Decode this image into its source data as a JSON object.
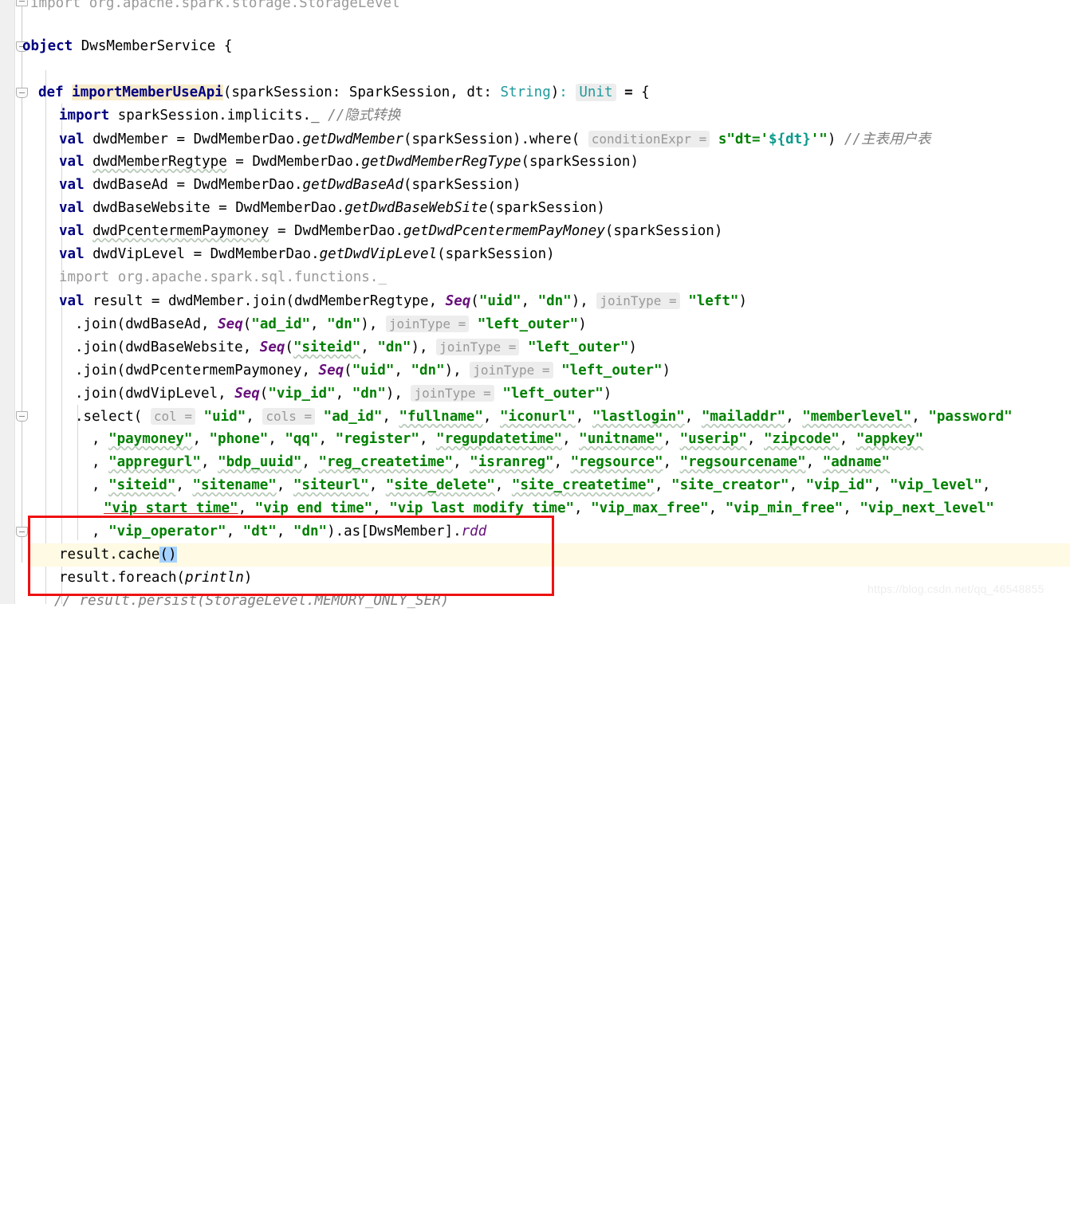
{
  "editor": {
    "language": "Scala",
    "theme_background": "#ffffff",
    "gutter_background": "#f0f0f0",
    "caret_line_color": "#fffae3",
    "selection_color": "#a6d2ff",
    "identifier_highlight_color": "#f7eccb",
    "annotation_box_color": "#ee1111",
    "keyword_color": "#000080",
    "string_color": "#008000",
    "comment_color": "#808080",
    "hint_color": "#999999",
    "type_color": "#20999d"
  },
  "lines": [
    {
      "n": 0,
      "text": "import org.apache.spark.storage.StorageLevel"
    },
    {
      "n": 1,
      "text": ""
    },
    {
      "n": 2,
      "text": "object DwsMemberService {"
    },
    {
      "n": 3,
      "text": ""
    },
    {
      "n": 4,
      "text": "  def importMemberUseApi(sparkSession: SparkSession, dt: String): Unit = {"
    },
    {
      "n": 5,
      "text": "    import sparkSession.implicits._ //隐式转换"
    },
    {
      "n": 6,
      "text": "    val dwdMember = DwdMemberDao.getDwdMember(sparkSession).where( conditionExpr = s\"dt='${dt}'\") //主表用户表"
    },
    {
      "n": 7,
      "text": "    val dwdMemberRegtype = DwdMemberDao.getDwdMemberRegType(sparkSession)"
    },
    {
      "n": 8,
      "text": "    val dwdBaseAd = DwdMemberDao.getDwdBaseAd(sparkSession)"
    },
    {
      "n": 9,
      "text": "    val dwdBaseWebsite = DwdMemberDao.getDwdBaseWebSite(sparkSession)"
    },
    {
      "n": 10,
      "text": "    val dwdPcentermemPaymoney = DwdMemberDao.getDwdPcentermemPayMoney(sparkSession)"
    },
    {
      "n": 11,
      "text": "    val dwdVipLevel = DwdMemberDao.getDwdVipLevel(sparkSession)"
    },
    {
      "n": 12,
      "text": "    import org.apache.spark.sql.functions._"
    },
    {
      "n": 13,
      "text": "    val result = dwdMember.join(dwdMemberRegtype, Seq(\"uid\", \"dn\"), joinType = \"left\")"
    },
    {
      "n": 14,
      "text": "      .join(dwdBaseAd, Seq(\"ad_id\", \"dn\"), joinType = \"left_outer\")"
    },
    {
      "n": 15,
      "text": "      .join(dwdBaseWebsite, Seq(\"siteid\", \"dn\"), joinType = \"left_outer\")"
    },
    {
      "n": 16,
      "text": "      .join(dwdPcentermemPaymoney, Seq(\"uid\", \"dn\"), joinType = \"left_outer\")"
    },
    {
      "n": 17,
      "text": "      .join(dwdVipLevel, Seq(\"vip_id\", \"dn\"), joinType = \"left_outer\")"
    },
    {
      "n": 18,
      "text": "      .select( col = \"uid\", cols = \"ad_id\", \"fullname\", \"iconurl\", \"lastlogin\", \"mailaddr\", \"memberlevel\", \"password\""
    },
    {
      "n": 19,
      "text": "        , \"paymoney\", \"phone\", \"qq\", \"register\", \"regupdatetime\", \"unitname\", \"userip\", \"zipcode\", \"appkey\""
    },
    {
      "n": 20,
      "text": "        , \"appregurl\", \"bdp_uuid\", \"reg_createtime\", \"isranreg\", \"regsource\", \"regsourcename\", \"adname\""
    },
    {
      "n": 21,
      "text": "        , \"siteid\", \"sitename\", \"siteurl\", \"site_delete\", \"site_createtime\", \"site_creator\", \"vip_id\", \"vip_level\","
    },
    {
      "n": 22,
      "text": "        \"vip start time\", \"vip end time\", \"vip last modify time\", \"vip_max_free\", \"vip_min_free\", \"vip_next_level\""
    },
    {
      "n": 23,
      "text": "        , \"vip_operator\", \"dt\", \"dn\").as[DwsMember].rdd"
    },
    {
      "n": 24,
      "text": "    result.cache()"
    },
    {
      "n": 25,
      "text": "    result.foreach(println)"
    },
    {
      "n": 26,
      "text": "    // result.persist(StorageLevel.MEMORY_ONLY_SER)"
    }
  ],
  "inlay_hints": [
    {
      "label": "conditionExpr",
      "line": 6
    },
    {
      "label": "joinType",
      "line": 13
    },
    {
      "label": "joinType",
      "line": 14
    },
    {
      "label": "joinType",
      "line": 15
    },
    {
      "label": "joinType",
      "line": 16
    },
    {
      "label": "joinType",
      "line": 17
    },
    {
      "label": "col",
      "line": 18
    },
    {
      "label": "cols",
      "line": 18
    }
  ],
  "comments": {
    "implicit_conversion": "//隐式转换",
    "main_table": "//主表用户表"
  },
  "selection": {
    "text": "()",
    "line": 24
  },
  "highlighted_identifier": "importMemberUseApi",
  "caret_line_number": 24,
  "annotation": {
    "type": "red-rectangle",
    "covers_lines": [
      23,
      24,
      25
    ]
  },
  "watermark": "https://blog.csdn.net/qq_46548855"
}
